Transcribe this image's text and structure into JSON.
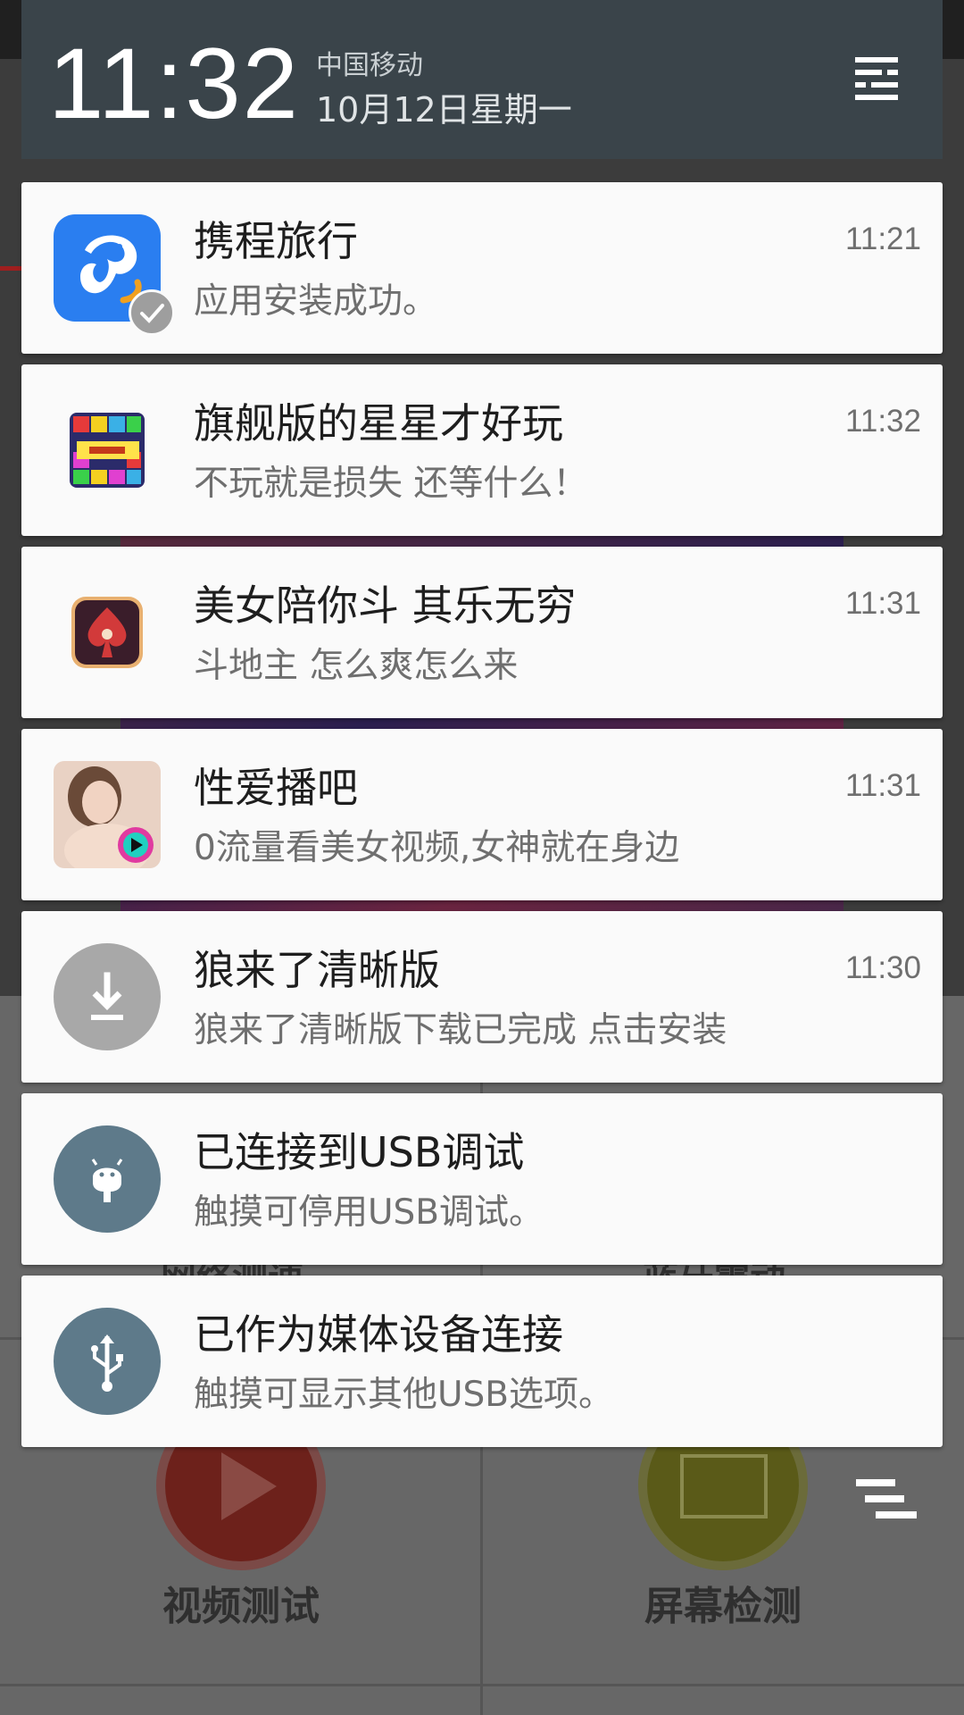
{
  "status_header": {
    "time": "11:32",
    "carrier": "中国移动",
    "date": "10月12日星期一",
    "settings_icon": "settings-menu-icon"
  },
  "notifications": [
    {
      "app": "ctrip",
      "icon": "ctrip-dolphin-icon",
      "badge": "check-badge-icon",
      "title": "携程旅行",
      "text": "应用安装成功。",
      "time": "11:21"
    },
    {
      "app": "popstar",
      "icon": "popstar-game-icon",
      "title": "旗舰版的星星才好玩",
      "text": "不玩就是损失 还等什么！",
      "time": "11:32"
    },
    {
      "app": "doudizhu",
      "icon": "poker-spade-icon",
      "title": "美女陪你斗 其乐无穷",
      "text": "斗地主  怎么爽怎么来",
      "time": "11:31"
    },
    {
      "app": "video-bar",
      "icon": "video-app-icon",
      "title": "性爱播吧",
      "text": "0流量看美女视频,女神就在身边",
      "time": "11:31"
    },
    {
      "app": "download",
      "icon": "download-icon",
      "title": "狼来了清晰版",
      "text": "狼来了清晰版下载已完成  点击安装",
      "time": "11:30"
    },
    {
      "app": "usb-debug",
      "icon": "android-debug-icon",
      "title": "已连接到USB调试",
      "text": "触摸可停用USB调试。",
      "time": ""
    },
    {
      "app": "usb-media",
      "icon": "usb-icon",
      "title": "已作为媒体设备连接",
      "text": "触摸可显示其他USB选项。",
      "time": ""
    }
  ],
  "background_app": {
    "tile_left_label": "视频测试",
    "tile_right_label": "屏幕检测",
    "partial_left_label": "网络测速",
    "partial_right_label": "蓝牙震动"
  },
  "clear_all_icon": "clear-all-icon",
  "colors": {
    "header_bg": "#3a444a",
    "card_bg": "#fafafa",
    "ctrip_blue": "#2a7ef0",
    "usb_slate": "#5e7a8a",
    "download_grey": "#a8a8a8"
  }
}
